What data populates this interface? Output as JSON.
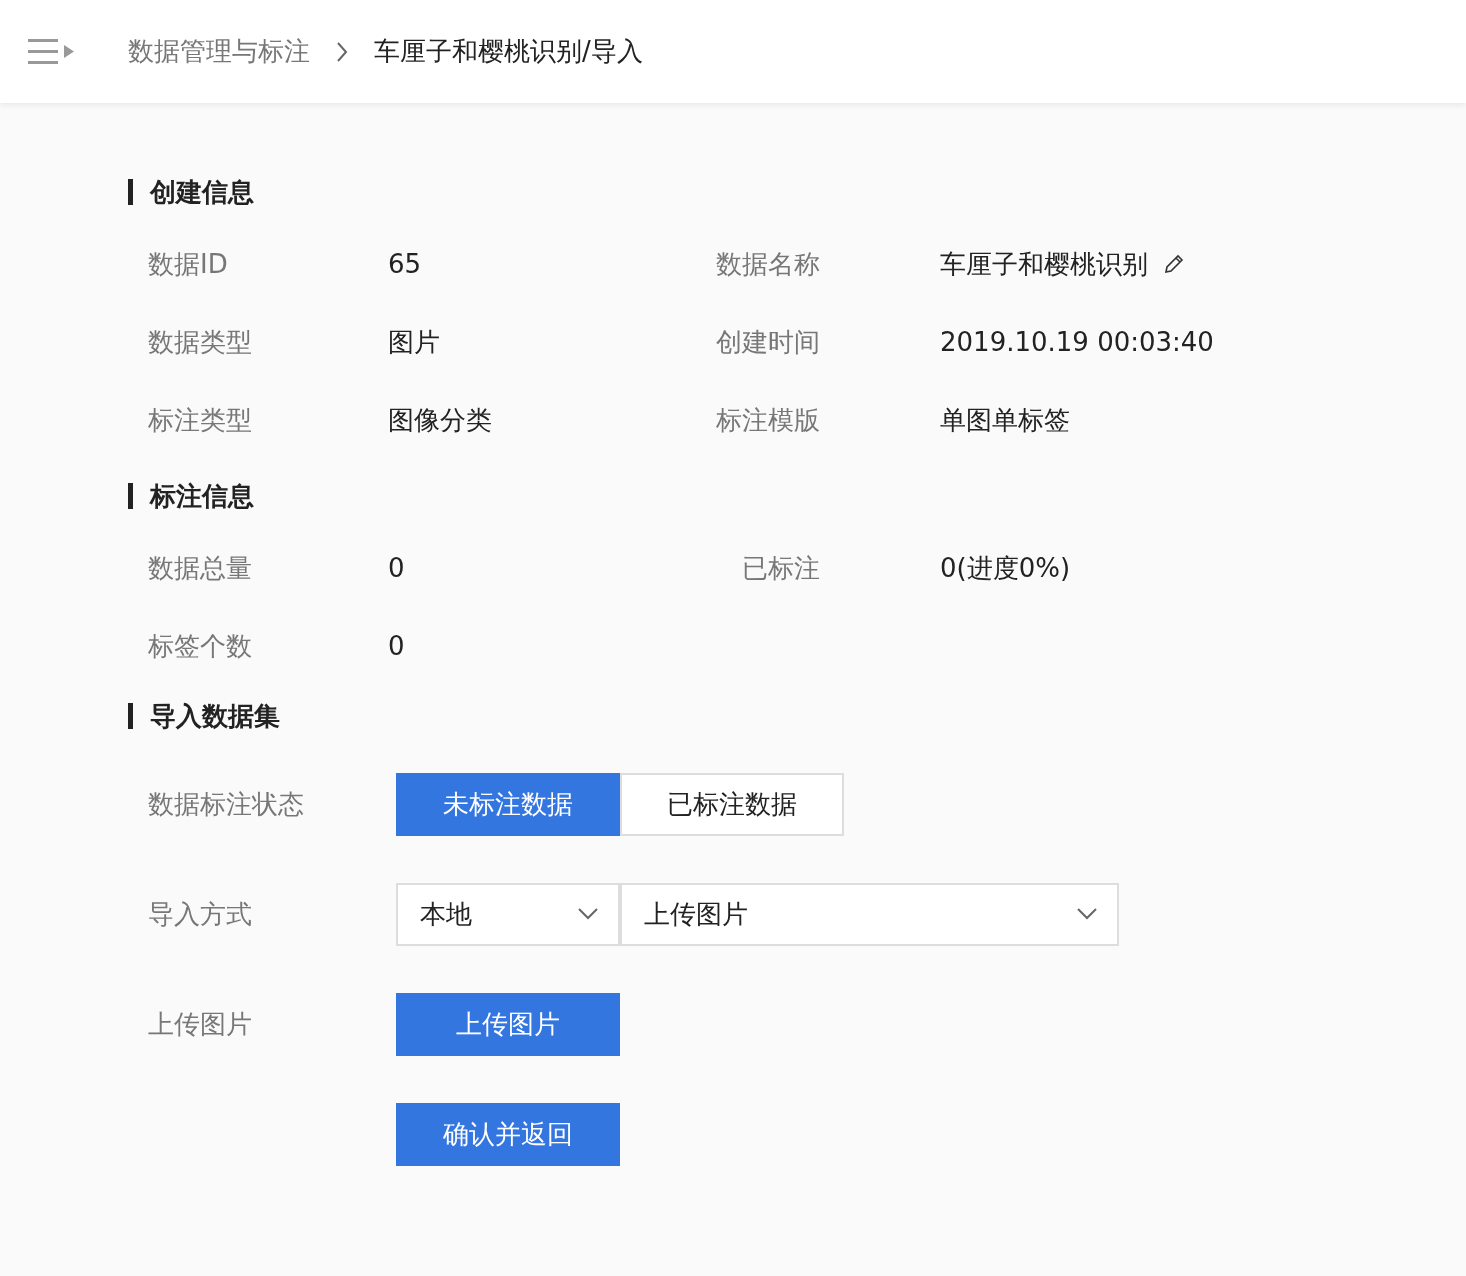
{
  "header": {
    "breadcrumb": [
      {
        "label": "数据管理与标注",
        "current": false
      },
      {
        "label": "车厘子和樱桃识别/导入",
        "current": true
      }
    ]
  },
  "sections": [
    {
      "title": "创建信息",
      "fields": [
        {
          "label": "数据ID",
          "value": "65",
          "editable": false
        },
        {
          "label": "数据名称",
          "value": "车厘子和樱桃识别",
          "editable": true
        },
        {
          "label": "数据类型",
          "value": "图片",
          "editable": false
        },
        {
          "label": "创建时间",
          "value": "2019.10.19 00:03:40",
          "editable": false
        },
        {
          "label": "标注类型",
          "value": "图像分类",
          "editable": false
        },
        {
          "label": "标注模版",
          "value": "单图单标签",
          "editable": false
        }
      ]
    },
    {
      "title": "标注信息",
      "fields": [
        {
          "label": "数据总量",
          "value": "0",
          "editable": false
        },
        {
          "label": "已标注",
          "value": "0(进度0%)",
          "editable": false
        },
        {
          "label": "标签个数",
          "value": "0",
          "editable": false
        }
      ]
    }
  ],
  "import": {
    "title": "导入数据集",
    "status": {
      "label": "数据标注状态",
      "options": [
        {
          "label": "未标注数据",
          "selected": true
        },
        {
          "label": "已标注数据",
          "selected": false
        }
      ]
    },
    "method": {
      "label": "导入方式",
      "source": "本地",
      "type": "上传图片"
    },
    "upload": {
      "label": "上传图片",
      "button": "上传图片"
    },
    "confirm": "确认并返回"
  }
}
